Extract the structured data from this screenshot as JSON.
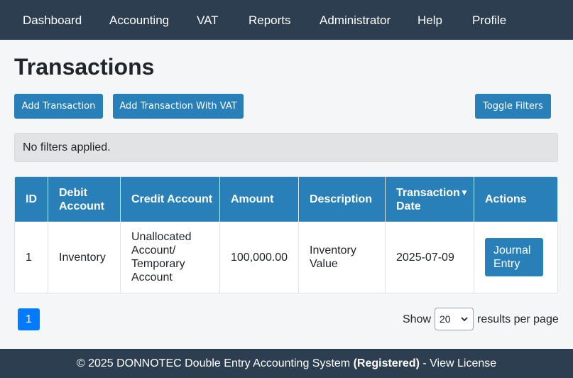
{
  "nav": {
    "items": [
      {
        "label": "Dashboard"
      },
      {
        "label": "Accounting"
      },
      {
        "label": "VAT"
      },
      {
        "label": "Reports"
      },
      {
        "label": "Administrator"
      },
      {
        "label": "Help"
      },
      {
        "label": "Profile"
      }
    ]
  },
  "page": {
    "title": "Transactions"
  },
  "toolbar": {
    "add_transaction": "Add Transaction",
    "add_transaction_vat": "Add Transaction With VAT",
    "toggle_filters": "Toggle Filters"
  },
  "filters": {
    "status": "No filters applied."
  },
  "table": {
    "headers": [
      "ID",
      "Debit Account",
      "Credit Account",
      "Amount",
      "Description",
      "Transaction Date",
      "Actions"
    ],
    "sort_indicator": "▼",
    "rows": [
      {
        "id": "1",
        "debit": "Inventory",
        "credit": "Unallocated Account/ Temporary Account",
        "amount": "100,000.00",
        "description": "Inventory Value",
        "date": "2025-07-09",
        "action": "Journal Entry"
      }
    ]
  },
  "pagination": {
    "current_page": "1",
    "show_label": "Show",
    "per_page_value": "20",
    "results_label": "results per page"
  },
  "footer": {
    "prefix": "© 2025 DONNOTEC Double Entry Accounting System",
    "status": "(Registered)",
    "separator": "-",
    "link": "View License"
  },
  "colors": {
    "navbar": "#2c3e50",
    "primary": "#2980b9",
    "page_active": "#007bff"
  }
}
